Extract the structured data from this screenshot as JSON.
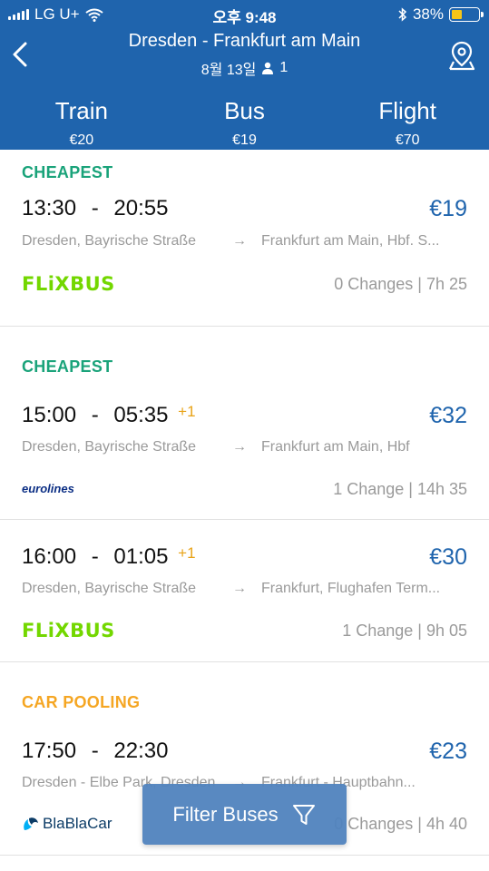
{
  "status_bar": {
    "carrier": "LG U+",
    "time": "오후 9:48",
    "battery": "38%",
    "battery_level": 0.38
  },
  "header": {
    "title": "Dresden - Frankfurt am Main",
    "date": "8월 13일",
    "passengers": "1",
    "back_icon": "chevron-left-icon",
    "map_icon": "map-pin-icon"
  },
  "tabs": [
    {
      "label": "Train",
      "price": "€20"
    },
    {
      "label": "Bus",
      "price": "€19"
    },
    {
      "label": "Flight",
      "price": "€70"
    }
  ],
  "colors": {
    "header_bg": "#1f64ad",
    "tab_indicator": "#f5a623",
    "price": "#1f64ad",
    "tag_cheapest": "#1aa37a",
    "tag_carpool": "#f5a623"
  },
  "results": [
    {
      "tag": "CHEAPEST",
      "depart": "13:30",
      "arrive": "20:55",
      "day_offset": "",
      "price": "€19",
      "from": "Dresden, Bayrische Straße",
      "to": "Frankfurt am Main, Hbf. S...",
      "operator": "FLiXBUS",
      "changes": "0 Changes | 7h 25"
    },
    {
      "tag": "CHEAPEST",
      "depart": "15:00",
      "arrive": "05:35",
      "day_offset": "+1",
      "price": "€32",
      "from": "Dresden, Bayrische Straße",
      "to": "Frankfurt am Main, Hbf",
      "operator": "eurolines",
      "changes": "1 Change | 14h 35"
    },
    {
      "tag": "",
      "depart": "16:00",
      "arrive": "01:05",
      "day_offset": "+1",
      "price": "€30",
      "from": "Dresden, Bayrische Straße",
      "to": "Frankfurt, Flughafen Term...",
      "operator": "FLiXBUS",
      "changes": "1 Change | 9h 05"
    },
    {
      "tag": "CAR POOLING",
      "depart": "17:50",
      "arrive": "22:30",
      "day_offset": "",
      "price": "€23",
      "from": "Dresden - Elbe Park, Dresden",
      "to": "Frankfurt - Hauptbahn...",
      "operator": "BlaBlaCar",
      "changes": "0 Changes | 4h 40"
    }
  ],
  "time_separator": "-",
  "route_arrow": "→",
  "filter_button": {
    "label": "Filter Buses",
    "icon": "filter-funnel-icon"
  }
}
